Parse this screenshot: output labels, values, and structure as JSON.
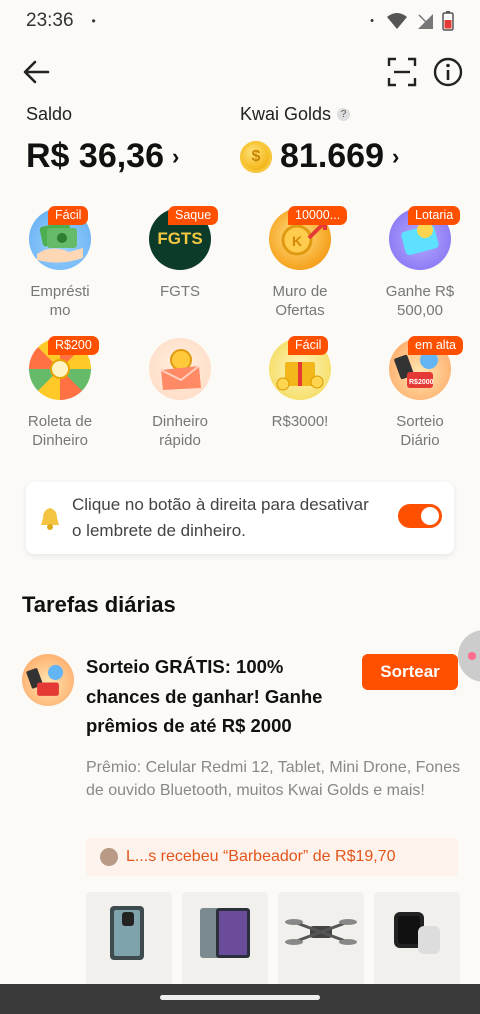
{
  "status": {
    "time": "23:36",
    "dot": "•",
    "signal_dot": "•"
  },
  "balance": {
    "saldo_label": "Saldo",
    "saldo_value": "R$ 36,36",
    "golds_label": "Kwai Golds",
    "golds_help": "?",
    "golds_value": "81.669"
  },
  "services": [
    {
      "name": "Empréstimo",
      "badge": "Fácil",
      "icon": "money-hand-icon"
    },
    {
      "name": "FGTS",
      "badge": "Saque",
      "icon": "fgts-icon",
      "icon_text": "FGTS"
    },
    {
      "name": "Muro de Ofertas",
      "badge": "10000...",
      "icon": "coin-arrow-icon"
    },
    {
      "name": "Ganhe R$ 500,00",
      "badge": "Lotaria",
      "icon": "lottery-icon"
    },
    {
      "name": "Roleta de Dinheiro",
      "badge": "R$200",
      "icon": "roulette-icon"
    },
    {
      "name": "Dinheiro rápido",
      "badge": "",
      "icon": "envelope-coin-icon"
    },
    {
      "name": "R$3000!",
      "badge": "Fácil",
      "icon": "gift-coins-icon"
    },
    {
      "name": "Sorteio Diário",
      "badge": "em alta",
      "icon": "prize-icon"
    }
  ],
  "reminder": {
    "text": "Clique no botão à direita para desativar o lembrete de dinheiro.",
    "toggle_on": true
  },
  "tasks": {
    "section_title": "Tarefas diárias",
    "task1": {
      "title": "Sorteio GRÁTIS: 100% chances de ganhar! Ganhe prêmios de até R$ 2000",
      "button": "Sortear",
      "description": "Prêmio: Celular Redmi 12, Tablet, Mini Drone, Fones de ouvido Bluetooth, muitos Kwai Golds e mais!",
      "ticker": "L...s recebeu “Barbeador” de R$19,70"
    }
  },
  "colors": {
    "accent": "#ff5000",
    "background": "#fbfaf7"
  }
}
